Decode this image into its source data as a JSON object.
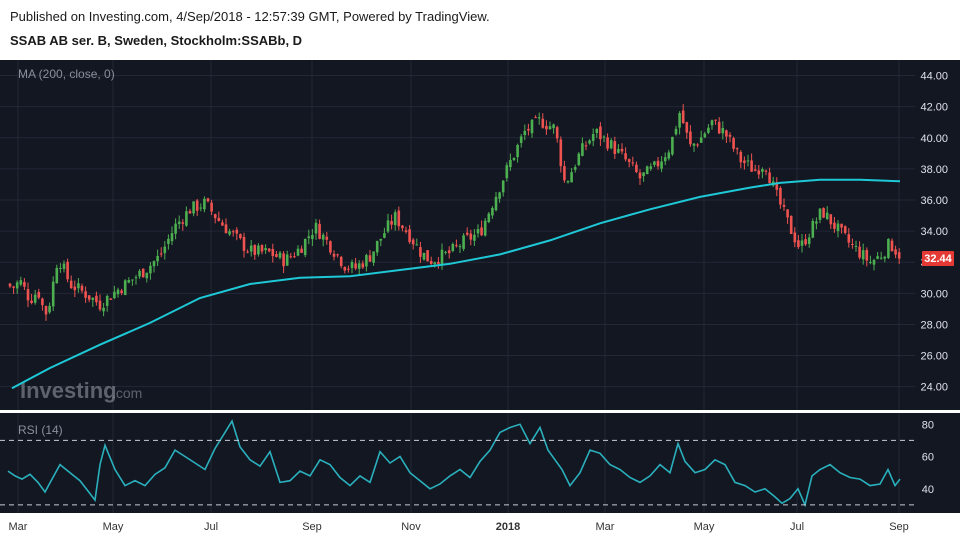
{
  "header": {
    "published": "Published on Investing.com, 4/Sep/2018 - 12:57:39 GMT, Powered by TradingView.",
    "symbol": "SSAB AB ser. B, Sweden, Stockholm:SSABb, D"
  },
  "watermark": {
    "brand": "Investing",
    "suffix": ".com"
  },
  "colors": {
    "background": "#131722",
    "grid": "#232736",
    "up": "#26a69a",
    "up_body": "#4caf50",
    "down": "#ef5350",
    "ma": "#1ec8d6",
    "rsi": "#2ab0bd",
    "price_tag": "#e53935"
  },
  "chart_data": [
    {
      "type": "candlestick",
      "title": "MA (200, close, 0)",
      "y_ticks": [
        "44.00",
        "42.00",
        "40.00",
        "38.00",
        "36.00",
        "34.00",
        "32.00",
        "30.00",
        "28.00",
        "26.00",
        "24.00"
      ],
      "ylim": [
        22.5,
        45.0
      ],
      "x_ticks": [
        "Mar",
        "May",
        "Jul",
        "Sep",
        "Nov",
        "2018",
        "Mar",
        "May",
        "Jul",
        "Sep"
      ],
      "last_price": "32.44",
      "close_anchors": [
        [
          0,
          31.2
        ],
        [
          12,
          30.3
        ],
        [
          20,
          30.8
        ],
        [
          30,
          29.6
        ],
        [
          38,
          30.2
        ],
        [
          45,
          28.6
        ],
        [
          50,
          29.5
        ],
        [
          58,
          32.4
        ],
        [
          70,
          30.6
        ],
        [
          85,
          30.0
        ],
        [
          100,
          29.3
        ],
        [
          115,
          30.1
        ],
        [
          130,
          30.8
        ],
        [
          145,
          31.5
        ],
        [
          160,
          32.4
        ],
        [
          175,
          34.3
        ],
        [
          190,
          35.4
        ],
        [
          205,
          35.8
        ],
        [
          220,
          34.6
        ],
        [
          235,
          33.6
        ],
        [
          250,
          32.7
        ],
        [
          270,
          32.6
        ],
        [
          285,
          32.1
        ],
        [
          300,
          32.9
        ],
        [
          315,
          34.3
        ],
        [
          330,
          33.1
        ],
        [
          345,
          31.8
        ],
        [
          355,
          31.6
        ],
        [
          370,
          32.4
        ],
        [
          385,
          34.0
        ],
        [
          395,
          34.9
        ],
        [
          408,
          33.9
        ],
        [
          420,
          32.7
        ],
        [
          430,
          32.1
        ],
        [
          450,
          32.6
        ],
        [
          465,
          33.4
        ],
        [
          480,
          33.9
        ],
        [
          495,
          36.2
        ],
        [
          510,
          38.4
        ],
        [
          525,
          40.4
        ],
        [
          540,
          41.1
        ],
        [
          555,
          40.6
        ],
        [
          565,
          37.0
        ],
        [
          580,
          39.0
        ],
        [
          595,
          40.4
        ],
        [
          610,
          39.6
        ],
        [
          625,
          38.6
        ],
        [
          640,
          37.4
        ],
        [
          655,
          38.1
        ],
        [
          670,
          39.4
        ],
        [
          680,
          41.7
        ],
        [
          690,
          39.4
        ],
        [
          700,
          39.9
        ],
        [
          712,
          41.0
        ],
        [
          725,
          40.3
        ],
        [
          740,
          38.6
        ],
        [
          755,
          37.9
        ],
        [
          765,
          38.4
        ],
        [
          775,
          36.5
        ],
        [
          790,
          34.2
        ],
        [
          800,
          32.9
        ],
        [
          810,
          34.0
        ],
        [
          822,
          35.3
        ],
        [
          835,
          34.3
        ],
        [
          848,
          33.3
        ],
        [
          860,
          32.6
        ],
        [
          870,
          32.0
        ],
        [
          880,
          32.4
        ],
        [
          890,
          33.2
        ],
        [
          900,
          32.44
        ]
      ],
      "ma_200": [
        [
          12,
          23.9
        ],
        [
          50,
          25.2
        ],
        [
          100,
          26.7
        ],
        [
          150,
          28.1
        ],
        [
          200,
          29.7
        ],
        [
          250,
          30.6
        ],
        [
          300,
          31.0
        ],
        [
          350,
          31.1
        ],
        [
          400,
          31.5
        ],
        [
          450,
          31.9
        ],
        [
          500,
          32.5
        ],
        [
          550,
          33.4
        ],
        [
          600,
          34.5
        ],
        [
          650,
          35.4
        ],
        [
          700,
          36.2
        ],
        [
          750,
          36.8
        ],
        [
          780,
          37.1
        ],
        [
          820,
          37.3
        ],
        [
          860,
          37.3
        ],
        [
          900,
          37.2
        ]
      ]
    },
    {
      "type": "line",
      "title": "RSI (14)",
      "y_ticks": [
        "80",
        "60",
        "40"
      ],
      "ylim": [
        25,
        87
      ],
      "dashed_levels": [
        70,
        30
      ],
      "series": [
        [
          8,
          51
        ],
        [
          15,
          48
        ],
        [
          22,
          46
        ],
        [
          30,
          49
        ],
        [
          38,
          44
        ],
        [
          45,
          38
        ],
        [
          52,
          46
        ],
        [
          60,
          55
        ],
        [
          70,
          50
        ],
        [
          80,
          45
        ],
        [
          90,
          37
        ],
        [
          95,
          33
        ],
        [
          100,
          55
        ],
        [
          105,
          67
        ],
        [
          115,
          52
        ],
        [
          125,
          42
        ],
        [
          135,
          45
        ],
        [
          145,
          42
        ],
        [
          155,
          49
        ],
        [
          165,
          53
        ],
        [
          175,
          64
        ],
        [
          185,
          60
        ],
        [
          195,
          56
        ],
        [
          205,
          52
        ],
        [
          215,
          65
        ],
        [
          225,
          75
        ],
        [
          232,
          82
        ],
        [
          240,
          66
        ],
        [
          250,
          58
        ],
        [
          260,
          54
        ],
        [
          270,
          63
        ],
        [
          280,
          44
        ],
        [
          290,
          45
        ],
        [
          300,
          51
        ],
        [
          310,
          48
        ],
        [
          320,
          58
        ],
        [
          330,
          55
        ],
        [
          340,
          47
        ],
        [
          350,
          42
        ],
        [
          360,
          48
        ],
        [
          370,
          44
        ],
        [
          380,
          63
        ],
        [
          390,
          56
        ],
        [
          400,
          60
        ],
        [
          410,
          50
        ],
        [
          420,
          45
        ],
        [
          430,
          40
        ],
        [
          440,
          43
        ],
        [
          450,
          48
        ],
        [
          460,
          52
        ],
        [
          470,
          47
        ],
        [
          480,
          57
        ],
        [
          490,
          64
        ],
        [
          500,
          75
        ],
        [
          510,
          78
        ],
        [
          520,
          80
        ],
        [
          530,
          68
        ],
        [
          540,
          78
        ],
        [
          548,
          64
        ],
        [
          555,
          58
        ],
        [
          562,
          52
        ],
        [
          570,
          42
        ],
        [
          580,
          50
        ],
        [
          590,
          64
        ],
        [
          600,
          62
        ],
        [
          610,
          55
        ],
        [
          620,
          52
        ],
        [
          630,
          47
        ],
        [
          640,
          44
        ],
        [
          650,
          48
        ],
        [
          660,
          55
        ],
        [
          670,
          50
        ],
        [
          678,
          68
        ],
        [
          685,
          57
        ],
        [
          695,
          50
        ],
        [
          705,
          52
        ],
        [
          715,
          58
        ],
        [
          725,
          55
        ],
        [
          735,
          44
        ],
        [
          745,
          42
        ],
        [
          755,
          38
        ],
        [
          765,
          40
        ],
        [
          775,
          35
        ],
        [
          782,
          31
        ],
        [
          790,
          34
        ],
        [
          798,
          40
        ],
        [
          805,
          30
        ],
        [
          812,
          48
        ],
        [
          820,
          52
        ],
        [
          830,
          55
        ],
        [
          840,
          50
        ],
        [
          850,
          47
        ],
        [
          860,
          46
        ],
        [
          870,
          42
        ],
        [
          880,
          43
        ],
        [
          888,
          52
        ],
        [
          895,
          42
        ],
        [
          900,
          46
        ]
      ]
    }
  ]
}
